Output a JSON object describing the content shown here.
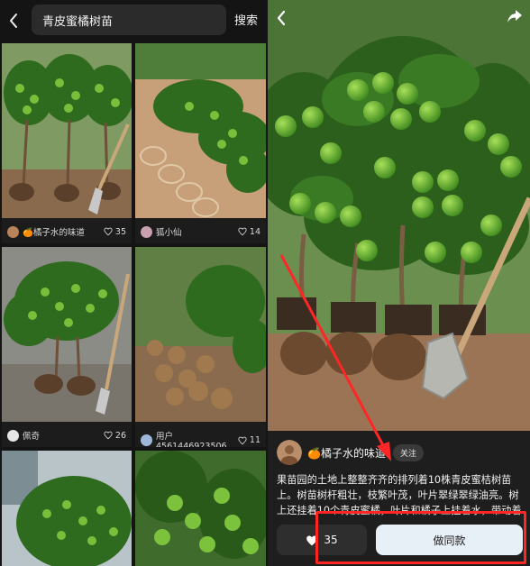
{
  "search": {
    "query": "青皮蜜橘树苗",
    "button_label": "搜索"
  },
  "results": [
    {
      "author": "🍊橘子水的味道",
      "likes": "35"
    },
    {
      "author": "狐小仙",
      "likes": "14"
    },
    {
      "author": "佩奇",
      "likes": "26"
    },
    {
      "author": "用户4561446923506",
      "likes": "11"
    }
  ],
  "detail": {
    "author": "🍊橘子水的味道",
    "follow_label": "关注",
    "description": "果苗园的土地上整整齐齐的排列着10株青皮蜜桔树苗上。树苗树杆粗壮，枝繁叶茂，叶片翠绿翠绿油亮。树上还挂着10个青皮蜜橘，叶片和橘子上挂着水，带动着",
    "likes": "35",
    "make_same_label": "做同款"
  },
  "colors": {
    "annotation": "#ff2626",
    "fruit": "#5fae2e",
    "leaf": "#2f6b1f",
    "soil": "#9a7455"
  },
  "icons": {
    "back": "chevron-left-icon",
    "share": "share-icon",
    "like": "heart-icon"
  }
}
